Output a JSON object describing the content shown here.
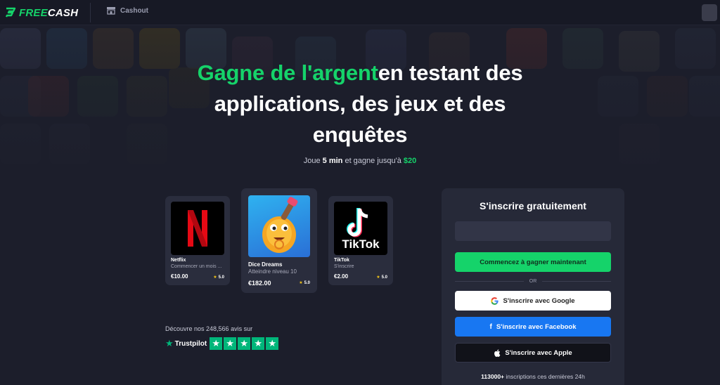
{
  "nav": {
    "brand_free": "FREE",
    "brand_cash": "CASH",
    "cashout_label": "Cashout"
  },
  "hero": {
    "headline_green": "Gagne de l'argent",
    "headline_rest": "en testant des",
    "headline_line2": "applications, des jeux et des",
    "headline_line3": "enquêtes",
    "sub_prefix": "Joue",
    "sub_time": "5 min",
    "sub_middle": "et gagne jusqu'à",
    "sub_amount": "$20"
  },
  "offers": [
    {
      "title": "Netflix",
      "subtitle": "Commencer un mois ...",
      "price": "€10.00",
      "rating": "5.0"
    },
    {
      "title": "Dice Dreams",
      "subtitle": "Atteindre niveau 10",
      "price": "€182.00",
      "rating": "5.0"
    },
    {
      "title": "TikTok",
      "subtitle": "S'inscrire",
      "price": "€2.00",
      "rating": "5.0",
      "logo_text": "TikTok"
    }
  ],
  "trustpilot": {
    "text": "Découvre nos 248,566 avis sur",
    "brand": "Trustpilot",
    "stars": 5
  },
  "signup": {
    "title": "S'inscrire gratuitement",
    "email_placeholder": "",
    "start_button": "Commencez à gagner maintenant",
    "or_text": "OR",
    "google_button": "S'inscrire avec Google",
    "facebook_button": "S'inscrire avec Facebook",
    "apple_button": "S'inscrire avec Apple",
    "foot_count": "113000+",
    "foot_text": "inscriptions ces dernières 24h"
  },
  "colors": {
    "accent": "#15d36a",
    "background": "#1c1e2b",
    "panel": "#262938",
    "facebook": "#1877f2",
    "trustpilot": "#00b67a"
  }
}
